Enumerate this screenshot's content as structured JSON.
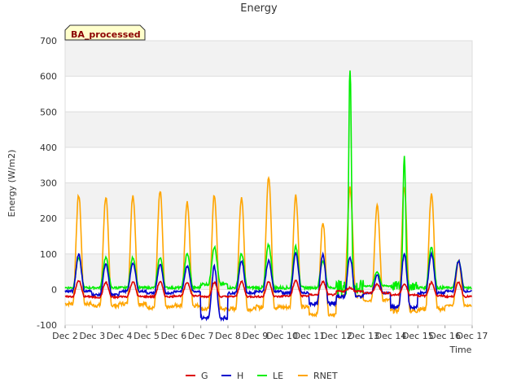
{
  "chart_data": {
    "type": "line",
    "title": "Energy",
    "xlabel": "Time",
    "ylabel": "Energy (W/m2)",
    "ylim": [
      -100,
      700
    ],
    "y_ticks": [
      -100,
      0,
      100,
      200,
      300,
      400,
      500,
      600,
      700
    ],
    "xlim": [
      2,
      17
    ],
    "x_ticks": [
      2,
      3,
      4,
      5,
      6,
      7,
      8,
      9,
      10,
      11,
      12,
      13,
      14,
      15,
      16,
      17
    ],
    "x_tick_labels": [
      "Dec 2",
      "Dec 3",
      "Dec 4",
      "Dec 5",
      "Dec 6",
      "Dec 7",
      "Dec 8",
      "Dec 9",
      "Dec 10",
      "Dec 11",
      "Dec 12",
      "Dec 13",
      "Dec 14",
      "Dec 15",
      "Dec 16",
      "Dec 17"
    ],
    "badge": "BA_processed",
    "grid": true,
    "legend_position": "bottom",
    "series": [
      {
        "name": "G",
        "color": "#dd0000",
        "days": [
          {
            "day": 2,
            "night": -20,
            "peak": 25
          },
          {
            "day": 3,
            "night": -22,
            "peak": 20
          },
          {
            "day": 4,
            "night": -20,
            "peak": 22
          },
          {
            "day": 5,
            "night": -20,
            "peak": 22
          },
          {
            "day": 6,
            "night": -18,
            "peak": 20
          },
          {
            "day": 7,
            "night": -20,
            "peak": 20
          },
          {
            "day": 8,
            "night": -20,
            "peak": 22
          },
          {
            "day": 9,
            "night": -20,
            "peak": 22
          },
          {
            "day": 10,
            "night": -18,
            "peak": 25
          },
          {
            "day": 11,
            "night": -15,
            "peak": 22
          },
          {
            "day": 12,
            "night": -5,
            "peak": 5
          },
          {
            "day": 13,
            "night": -10,
            "peak": 15
          },
          {
            "day": 14,
            "night": -15,
            "peak": 15
          },
          {
            "day": 15,
            "night": -18,
            "peak": 20
          },
          {
            "day": 16,
            "night": -20,
            "peak": 20
          }
        ]
      },
      {
        "name": "H",
        "color": "#0000cc",
        "days": [
          {
            "day": 2,
            "night": -5,
            "peak": 100
          },
          {
            "day": 3,
            "night": -15,
            "peak": 70
          },
          {
            "day": 4,
            "night": -5,
            "peak": 75
          },
          {
            "day": 5,
            "night": -10,
            "peak": 70
          },
          {
            "day": 6,
            "night": -5,
            "peak": 65
          },
          {
            "day": 7,
            "night": -80,
            "peak": 65
          },
          {
            "day": 8,
            "night": -10,
            "peak": 80
          },
          {
            "day": 9,
            "night": -5,
            "peak": 80
          },
          {
            "day": 10,
            "night": -10,
            "peak": 100
          },
          {
            "day": 11,
            "night": -40,
            "peak": 100
          },
          {
            "day": 12,
            "night": -20,
            "peak": 90
          },
          {
            "day": 13,
            "night": -10,
            "peak": 40
          },
          {
            "day": 14,
            "night": -50,
            "peak": 100
          },
          {
            "day": 15,
            "night": -10,
            "peak": 100
          },
          {
            "day": 16,
            "night": -5,
            "peak": 80
          }
        ]
      },
      {
        "name": "LE",
        "color": "#00ee00",
        "days": [
          {
            "day": 2,
            "night": 5,
            "peak": 90
          },
          {
            "day": 3,
            "night": 5,
            "peak": 90
          },
          {
            "day": 4,
            "night": 5,
            "peak": 90
          },
          {
            "day": 5,
            "night": 5,
            "peak": 90
          },
          {
            "day": 6,
            "night": 5,
            "peak": 100
          },
          {
            "day": 7,
            "night": 15,
            "peak": 120
          },
          {
            "day": 8,
            "night": 5,
            "peak": 100
          },
          {
            "day": 9,
            "night": 5,
            "peak": 125
          },
          {
            "day": 10,
            "night": 5,
            "peak": 120
          },
          {
            "day": 11,
            "night": 5,
            "peak": 80
          },
          {
            "day": 12,
            "night": 5,
            "peak": 620
          },
          {
            "day": 13,
            "night": 10,
            "peak": 50
          },
          {
            "day": 14,
            "night": 10,
            "peak": 385
          },
          {
            "day": 15,
            "night": 5,
            "peak": 120
          },
          {
            "day": 16,
            "night": 5,
            "peak": 80
          }
        ]
      },
      {
        "name": "RNET",
        "color": "#ffa500",
        "days": [
          {
            "day": 2,
            "night": -40,
            "peak": 265
          },
          {
            "day": 3,
            "night": -45,
            "peak": 260
          },
          {
            "day": 4,
            "night": -40,
            "peak": 265
          },
          {
            "day": 5,
            "night": -50,
            "peak": 275
          },
          {
            "day": 6,
            "night": -45,
            "peak": 245
          },
          {
            "day": 7,
            "night": -55,
            "peak": 265
          },
          {
            "day": 8,
            "night": -55,
            "peak": 260
          },
          {
            "day": 9,
            "night": -50,
            "peak": 320
          },
          {
            "day": 10,
            "night": -50,
            "peak": 265
          },
          {
            "day": 11,
            "night": -70,
            "peak": 190
          },
          {
            "day": 12,
            "night": -20,
            "peak": 285
          },
          {
            "day": 13,
            "night": -30,
            "peak": 235
          },
          {
            "day": 14,
            "night": -60,
            "peak": 285
          },
          {
            "day": 15,
            "night": -55,
            "peak": 270
          },
          {
            "day": 16,
            "night": -45,
            "peak": 80
          }
        ]
      }
    ]
  }
}
